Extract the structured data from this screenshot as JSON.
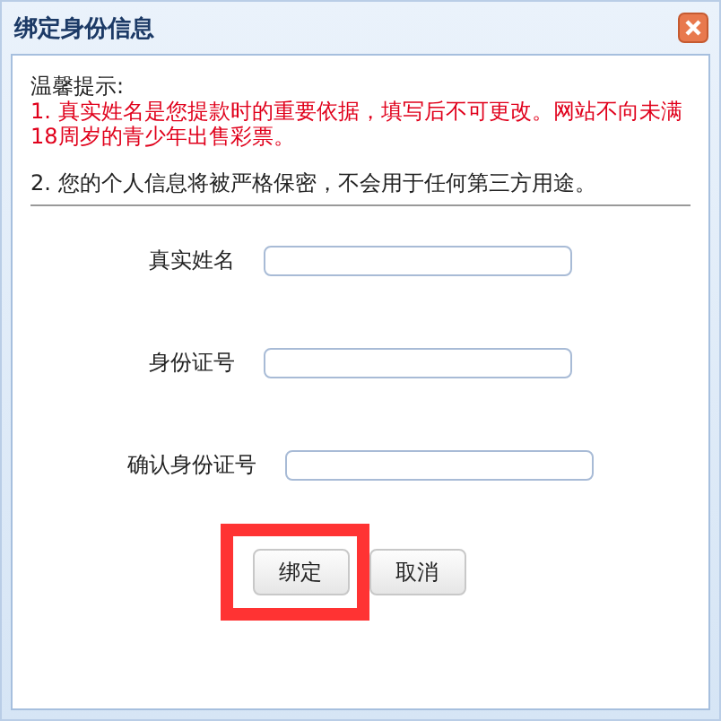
{
  "window": {
    "title": "绑定身份信息"
  },
  "notice": {
    "heading": "温馨提示:",
    "items": [
      {
        "text": "1. 真实姓名是您提款时的重要依据，填写后不可更改。网站不向未满18周岁的青少年出售彩票。",
        "kind": "warning"
      },
      {
        "text": "2. 您的个人信息将被严格保密，不会用于任何第三方用途。",
        "kind": "normal"
      }
    ]
  },
  "fields": [
    {
      "label": "真实姓名"
    },
    {
      "label": "身份证号"
    },
    {
      "label": "确认身份证号"
    }
  ],
  "buttons": [
    {
      "label": "绑定",
      "highlighted": true
    },
    {
      "label": "取消",
      "highlighted": false
    }
  ]
}
